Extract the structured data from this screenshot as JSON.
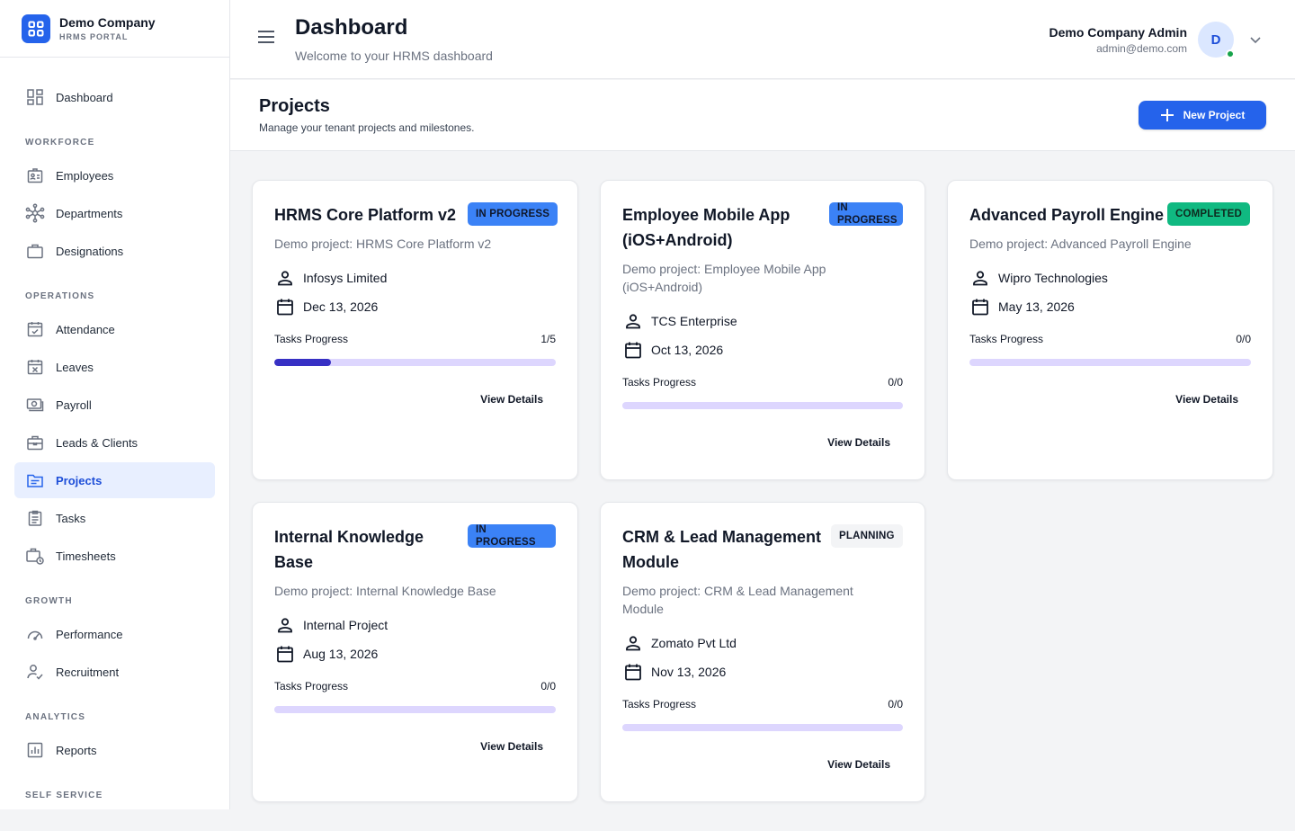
{
  "brand": {
    "name": "Demo Company",
    "subtitle": "HRMS PORTAL"
  },
  "sidebar": {
    "dashboard": "Dashboard",
    "sections": {
      "workforce": "WORKFORCE",
      "operations": "OPERATIONS",
      "growth": "GROWTH",
      "analytics": "ANALYTICS",
      "self_service": "SELF SERVICE"
    },
    "workforce": [
      "Employees",
      "Departments",
      "Designations"
    ],
    "operations": [
      "Attendance",
      "Leaves",
      "Payroll",
      "Leads & Clients",
      "Projects",
      "Tasks",
      "Timesheets"
    ],
    "growth": [
      "Performance",
      "Recruitment"
    ],
    "analytics": [
      "Reports"
    ],
    "active": "Projects"
  },
  "header": {
    "title": "Dashboard",
    "subtitle": "Welcome to your HRMS dashboard",
    "user_name": "Demo Company Admin",
    "user_email": "admin@demo.com",
    "avatar_initial": "D"
  },
  "page": {
    "title": "Projects",
    "subtitle": "Manage your tenant projects and milestones.",
    "new_button": "New Project"
  },
  "colors": {
    "accent": "#2563eb",
    "in_progress": "#3b82f6",
    "completed": "#10b981",
    "progress_fill": "#3730c4",
    "progress_track": "#ddd6fe"
  },
  "projects": [
    {
      "title": "HRMS Core Platform v2",
      "status": "IN PROGRESS",
      "description": "Demo project: HRMS Core Platform v2",
      "client": "Infosys Limited",
      "date": "Dec 13, 2026",
      "progress_label": "Tasks Progress",
      "progress_text": "1/5",
      "progress_fraction": 0.2,
      "action": "View Details"
    },
    {
      "title": "Employee Mobile App (iOS+Android)",
      "status": "IN PROGRESS",
      "description": "Demo project: Employee Mobile App (iOS+Android)",
      "client": "TCS Enterprise",
      "date": "Oct 13, 2026",
      "progress_label": "Tasks Progress",
      "progress_text": "0/0",
      "progress_fraction": 0,
      "action": "View Details"
    },
    {
      "title": "Advanced Payroll Engine",
      "status": "COMPLETED",
      "description": "Demo project: Advanced Payroll Engine",
      "client": "Wipro Technologies",
      "date": "May 13, 2026",
      "progress_label": "Tasks Progress",
      "progress_text": "0/0",
      "progress_fraction": 0,
      "action": "View Details"
    },
    {
      "title": "Internal Knowledge Base",
      "status": "IN PROGRESS",
      "description": "Demo project: Internal Knowledge Base",
      "client": "Internal Project",
      "date": "Aug 13, 2026",
      "progress_label": "Tasks Progress",
      "progress_text": "0/0",
      "progress_fraction": 0,
      "action": "View Details"
    },
    {
      "title": "CRM & Lead Management Module",
      "status": "PLANNING",
      "description": "Demo project: CRM & Lead Management Module",
      "client": "Zomato Pvt Ltd",
      "date": "Nov 13, 2026",
      "progress_label": "Tasks Progress",
      "progress_text": "0/0",
      "progress_fraction": 0,
      "action": "View Details"
    }
  ]
}
